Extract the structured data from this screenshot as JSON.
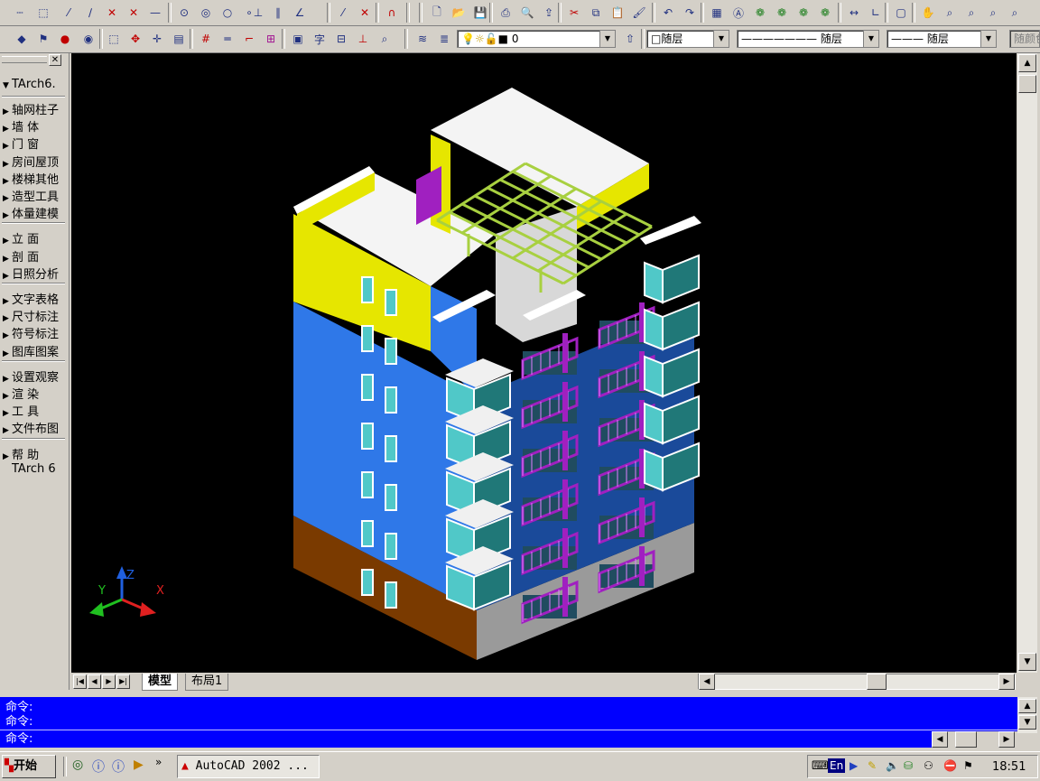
{
  "toolbar1": {
    "icons": [
      "line-icon",
      "rect-dotted-icon",
      "polyline-icon",
      "ortho-line-icon",
      "cross-icon",
      "cross-icon-2",
      "dash-line-icon",
      "circle-icon",
      "circle-2-icon",
      "circle-3-icon",
      "point-icon",
      "perpendicular-icon",
      "parallel-icon",
      "angle-icon",
      "snap-line-icon",
      "snap-none-icon",
      "magnet-icon",
      "new-file-icon",
      "open-folder-icon",
      "save-icon",
      "print-icon",
      "preview-icon",
      "publish-icon",
      "cut-icon",
      "copy-icon",
      "paste-icon",
      "match-prop-icon",
      "undo-icon",
      "redo-icon",
      "design-center-icon",
      "aec-icon",
      "render-icon",
      "render-2-icon",
      "render-3-icon",
      "render-4-icon",
      "dist-icon",
      "angle-measure-icon",
      "named-view-icon",
      "pan-icon",
      "zoom-realtime-icon",
      "zoom-window-icon",
      "zoom-prev-icon",
      "zoom-extents-icon"
    ]
  },
  "toolbar2": {
    "layer_value": "0",
    "color_value": "随层",
    "linetype_value": "随层",
    "lineweight_value": "随层",
    "plotstyle_value": "随颜色"
  },
  "panel": {
    "title": "TArch6.",
    "groups": [
      [
        "轴网柱子",
        "墙    体",
        "门    窗",
        "房间屋顶",
        "楼梯其他",
        "造型工具",
        "体量建模"
      ],
      [
        "立    面",
        "剖    面",
        "日照分析"
      ],
      [
        "文字表格",
        "尺寸标注",
        "符号标注",
        "图库图案"
      ],
      [
        "设置观察",
        "渲    染",
        "工    具",
        "文件布图"
      ],
      [
        "帮    助",
        "TArch 6"
      ]
    ]
  },
  "axes": {
    "x": "X",
    "y": "Y",
    "z": "Z"
  },
  "tabs": {
    "model": "模型",
    "layout1": "布局1"
  },
  "command": {
    "lines": [
      "命令:",
      "命令:",
      "命令:"
    ]
  },
  "taskbar": {
    "start": "开始",
    "task": "AutoCAD 2002 ...",
    "lang": "En",
    "clock": "18:51"
  },
  "colors": {
    "desktop_gray": "#d4d0c8",
    "canvas": "#000000",
    "command_bg": "#0000ff",
    "wall_blue": "#2f78e8",
    "parapet_yellow": "#e6e600",
    "railing_purple": "#a020c0",
    "pergola_green": "#a8d040",
    "glass_cyan": "#50c8c8",
    "base_brown": "#7a3a00"
  }
}
